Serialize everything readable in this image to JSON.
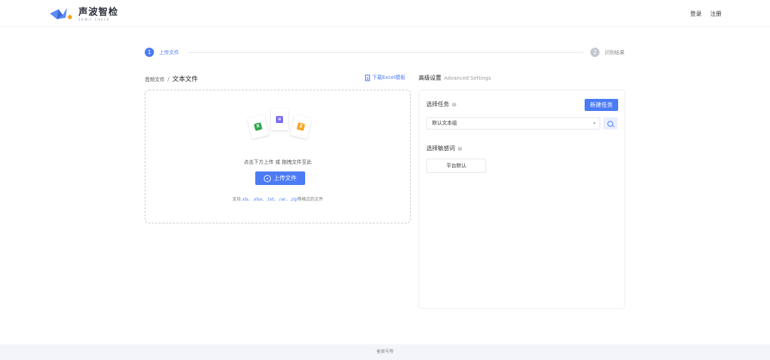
{
  "header": {
    "logo_text": "声波智检",
    "logo_sub": "SONIC CHECK",
    "login": "登录",
    "register": "注册"
  },
  "steps": [
    {
      "num": "1",
      "label": "上传文件",
      "active": true
    },
    {
      "num": "2",
      "label": "识别结果",
      "active": false
    }
  ],
  "left": {
    "breadcrumb_parent": "音频文件",
    "breadcrumb_sep": "/",
    "breadcrumb_current": "文本文件",
    "download_label": "下载Excel模板",
    "drop_hint": "点击下方上传 或 拖拽文件至此",
    "upload_label": "上传文件",
    "formats_prefix": "支持",
    "formats_ext": ".xls、.xlsx、.txt、.rar、.zip",
    "formats_suffix": "等格式的文件",
    "file_badges": [
      "X",
      "≡",
      "Z"
    ]
  },
  "right": {
    "title": "高级设置",
    "title_en": "Advanced Settings",
    "task_label": "选择任务",
    "new_task": "新建任务",
    "task_value": "默认文本组",
    "caret": "▾",
    "sensitive_label": "选择敏感词",
    "platform_default": "平台默认"
  },
  "footer": {
    "text": "备案号等"
  },
  "colors": {
    "accent": "#4b7bf5",
    "excel": "#2fa84f",
    "doc": "#7b6cf6",
    "zip": "#f5a623"
  }
}
